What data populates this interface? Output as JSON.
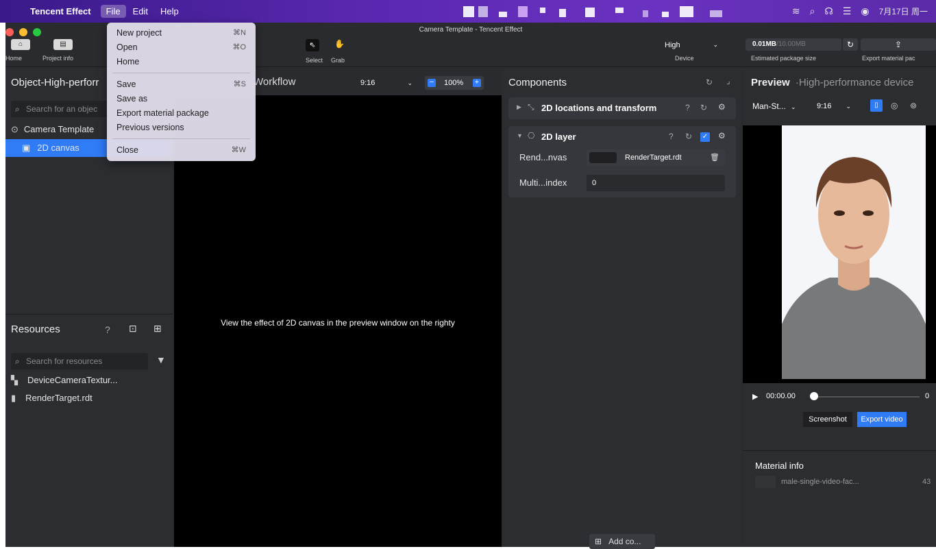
{
  "menubar": {
    "app_name": "Tencent Effect",
    "menus": [
      "File",
      "Edit",
      "Help"
    ],
    "clock": "7月17日 周一",
    "colors": {
      "gradient_start": "#3a1a8a",
      "gradient_end": "#6a32c0"
    }
  },
  "window": {
    "title": "Camera Template - Tencent Effect"
  },
  "toolbar": {
    "home_label": "Home",
    "project_info_label": "Project info",
    "select_label": "Select",
    "grab_label": "Grab",
    "device_value": "High",
    "device_label": "Device",
    "package_size_value": "0.01MB",
    "package_size_limit": "/10.00MB",
    "package_size_label": "Estimated package size",
    "export_label": "Export material pac"
  },
  "file_menu": {
    "items": [
      {
        "label": "New project",
        "shortcut": "⌘N"
      },
      {
        "label": "Open",
        "shortcut": "⌘O"
      },
      {
        "label": "Home",
        "shortcut": ""
      },
      {
        "label": "Save",
        "shortcut": "⌘S"
      },
      {
        "label": "Save as",
        "shortcut": ""
      },
      {
        "label": "Export material package",
        "shortcut": ""
      },
      {
        "label": "Previous versions",
        "shortcut": ""
      },
      {
        "label": "Close",
        "shortcut": "⌘W"
      }
    ]
  },
  "object_panel": {
    "title": "Object-High-perforr",
    "search_placeholder": "Search for an objec",
    "tree": [
      {
        "label": "Camera Template",
        "icon": "target-icon"
      },
      {
        "label": "2D canvas",
        "icon": "camera-icon",
        "selected": true
      }
    ]
  },
  "resources_panel": {
    "title": "Resources",
    "search_placeholder": "Search for resources",
    "items": [
      {
        "label": "DeviceCameraTextur...",
        "icon": "texture-icon"
      },
      {
        "label": "RenderTarget.rdt",
        "icon": "file-icon"
      }
    ]
  },
  "workflow": {
    "title": "Workflow",
    "ratio": "9:16",
    "zoom": "100%",
    "message": "View the effect of 2D canvas in the preview window on the righty"
  },
  "components_panel": {
    "title": "Components",
    "sections": [
      {
        "label": "2D locations and transform",
        "expanded": false
      },
      {
        "label": "2D layer",
        "expanded": true
      }
    ],
    "fields": [
      {
        "label": "Rend...nvas",
        "value": "RenderTarget.rdt"
      },
      {
        "label": "Multi...index",
        "value": "0"
      }
    ],
    "add_button": "Add co..."
  },
  "preview_panel": {
    "title": "Preview",
    "subtitle": "·High-performance device",
    "model": "Man-St...",
    "ratio": "9:16",
    "time": "00:00.00",
    "time_end": "0",
    "screenshot_label": "Screenshot",
    "export_video_label": "Export video",
    "material_info_title": "Material info",
    "material_name": "male-single-video-fac...",
    "material_size": "43"
  }
}
